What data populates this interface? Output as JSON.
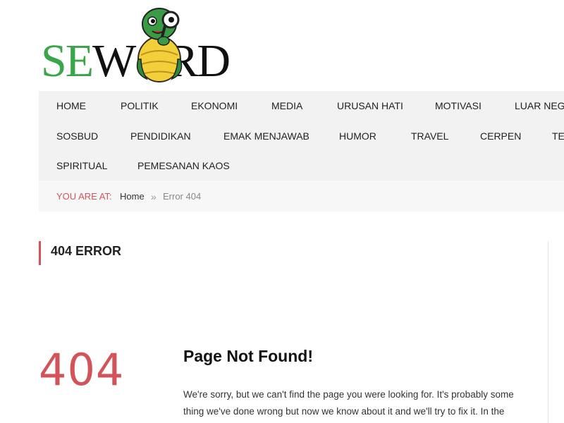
{
  "logo": {
    "text_green": "SE",
    "text_black": "RD",
    "letter_w": "W",
    "mascot": "turtle-mascot-with-magnifier"
  },
  "nav": {
    "row1": [
      "HOME",
      "POLITIK",
      "EKONOMI",
      "MEDIA",
      "URUSAN HATI",
      "MOTIVASI",
      "LUAR NEGERI"
    ],
    "row2": [
      "SOSBUD",
      "PENDIDIKAN",
      "EMAK MENJAWAB",
      "HUMOR",
      "TRAVEL",
      "CERPEN",
      "TEKNOLOGI"
    ],
    "row3": [
      "SPIRITUAL",
      "PEMESANAN KAOS"
    ]
  },
  "breadcrumb": {
    "you_are_at": "YOU ARE AT:",
    "home": "Home",
    "separator": "»",
    "current": "Error 404"
  },
  "section": {
    "heading": "404 ERROR"
  },
  "error": {
    "code": "404",
    "title": "Page Not Found!",
    "message": "We're sorry, but we can't find the page you were looking for. It's probably some thing we've done wrong but now we know about it and we'll try to fix it. In the"
  },
  "colors": {
    "accent": "#d2545a",
    "logo_green": "#3aa64a",
    "nav_bg": "#f2f2f2"
  }
}
